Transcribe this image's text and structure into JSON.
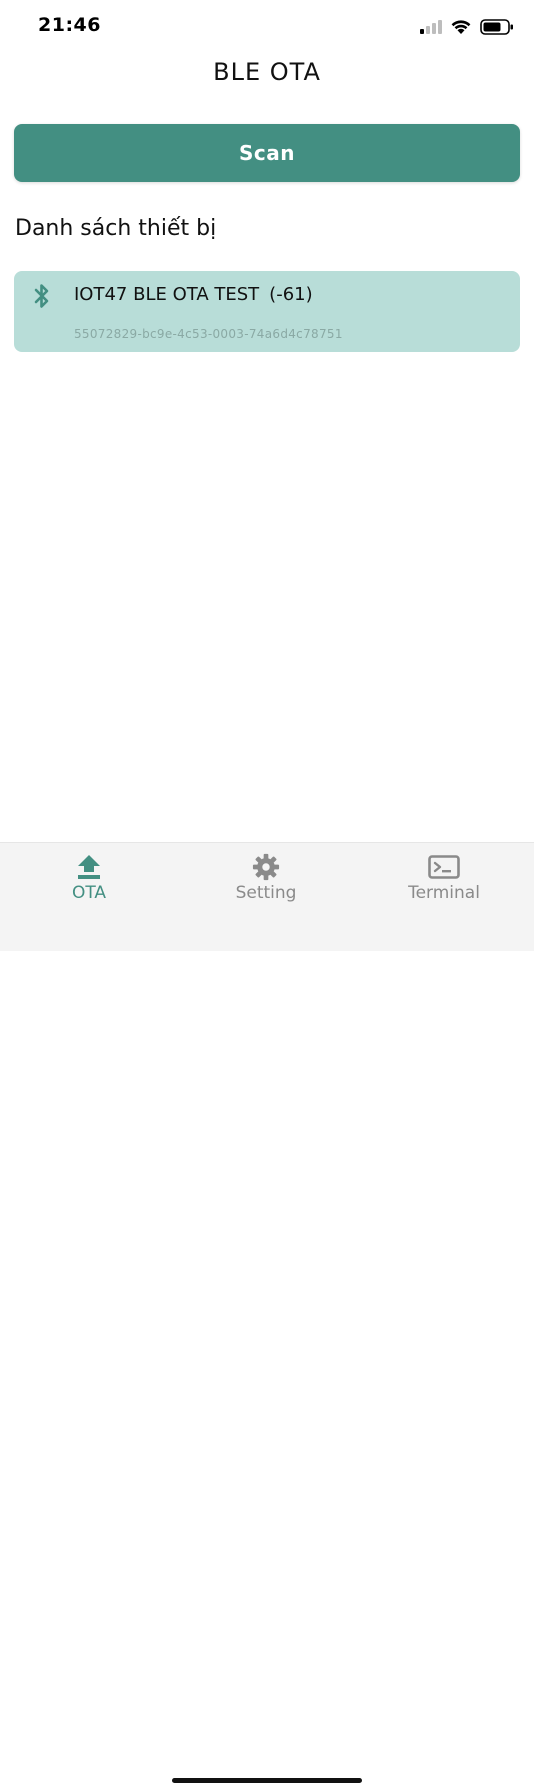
{
  "status_bar": {
    "time": "21:46",
    "icons": [
      "signal-icon",
      "wifi-icon",
      "battery-icon"
    ]
  },
  "header": {
    "title": "BLE OTA"
  },
  "scan": {
    "label": "Scan"
  },
  "devices_section": {
    "title": "Danh sách thiết bị"
  },
  "devices": [
    {
      "icon": "bluetooth-icon",
      "name": "IOT47 BLE OTA TEST",
      "rssi": "(-61)",
      "uuid": "55072829-bc9e-4c53-0003-74a6d4c78751"
    }
  ],
  "tabs": [
    {
      "label": "OTA",
      "icon": "upload-icon",
      "active": true
    },
    {
      "label": "Setting",
      "icon": "gear-icon",
      "active": false
    },
    {
      "label": "Terminal",
      "icon": "terminal-icon",
      "active": false
    }
  ],
  "colors": {
    "accent": "#438f82",
    "device_bg": "#b8ddd8",
    "tab_inactive": "#8a8a8a",
    "tab_bar_bg": "#f4f4f4"
  }
}
